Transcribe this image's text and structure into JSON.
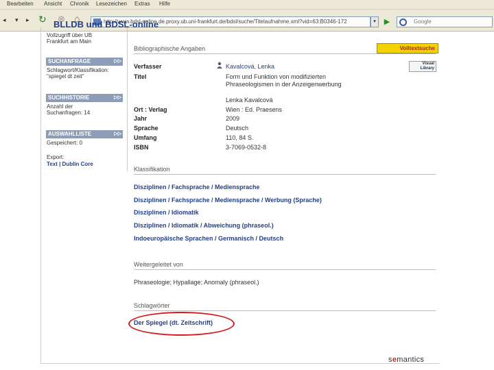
{
  "menu": [
    "Bearbeiten",
    "Ansicht",
    "Chronik",
    "Lesezeichen",
    "Extras",
    "Hilfe"
  ],
  "nav": {
    "back": "◂",
    "forward": "▸",
    "url": "http://www.bdsl-online.de.proxy.ub.uni-frankfurt.de/bdsl/suche/Titelaufnahme.xml?vid=63:B0346-172",
    "search_placeholder": "Google"
  },
  "slide_title": "BLLDB und BDSL-online",
  "left": {
    "access_text": [
      "Vollzugriff über UB",
      "Frankfurt am Main"
    ],
    "suchanfrage": {
      "title": "SUCHANFRAGE",
      "lines": [
        "Schlagwort/Klassifikation:",
        "\"spiegel dt zeit\""
      ]
    },
    "suchhistorie": {
      "title": "SUCHHISTORIE",
      "lines": [
        "Anzahl der",
        "Suchanfragen: 14"
      ]
    },
    "auswahlliste": {
      "title": "AUSWAHLLISTE",
      "lines": [
        "Gespeichert: 0"
      ],
      "export_label": "Export:",
      "export_links": "Text | Dublin Core"
    }
  },
  "main": {
    "section_biblio": "Bibliographische Angaben",
    "volltext_button": "Volltextsuche",
    "visual_library": "Visual Library",
    "fields": [
      {
        "label": "Verfasser",
        "value": "Kavalcová, Lenka"
      },
      {
        "label": "Titel",
        "value": "Form und Funktion von modifizierten Phraseologismen in der Anzeigenwerbung"
      },
      {
        "label": "",
        "value": "Lenka Kavalcová"
      },
      {
        "label": "Ort : Verlag",
        "value": "Wien : Ed. Praesens"
      },
      {
        "label": "Jahr",
        "value": "2009"
      },
      {
        "label": "Sprache",
        "value": "Deutsch"
      },
      {
        "label": "Umfang",
        "value": "110, 84 S."
      },
      {
        "label": "ISBN",
        "value": "3-7069-0532-8"
      }
    ],
    "section_klass": "Klassifikation",
    "klassifikation": [
      "Disziplinen / Fachsprache / Mediensprache",
      "Disziplinen / Fachsprache / Mediensprache / Werbung (Sprache)",
      "Disziplinen / Idiomatik",
      "Disziplinen / Idiomatik / Abweichung (phraseol.)",
      "Indoeuropäische Sprachen / Germanisch / Deutsch"
    ],
    "section_weiter": "Weitergeleitet von",
    "weiter_text": "Phraseologie; Hypallage; Anomaly (phraseol.)",
    "section_schlag": "Schlagwörter",
    "schlagwort": "Der Spiegel (dt. Zeitschrift)"
  },
  "footer_logo": {
    "pre": "s",
    "mid": "e",
    "post": "mantics"
  }
}
